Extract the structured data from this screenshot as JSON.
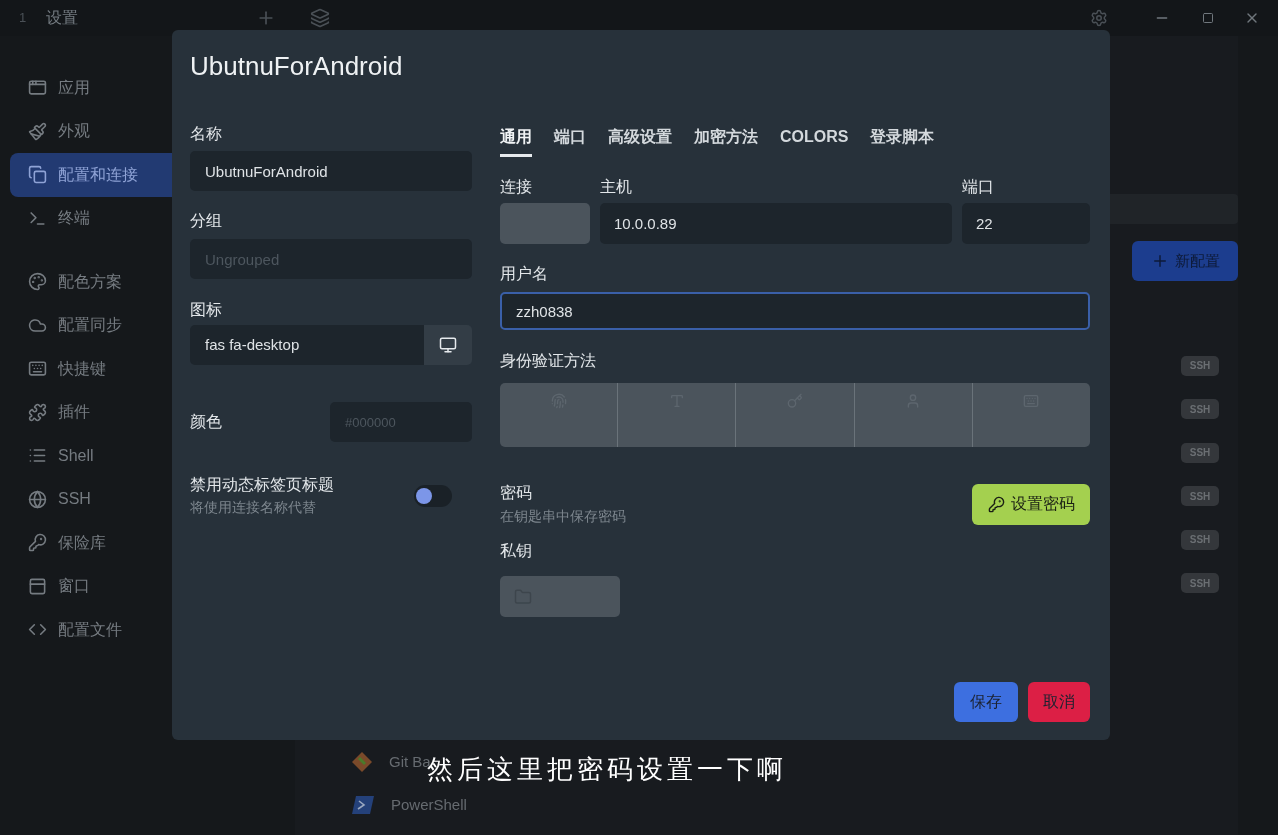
{
  "titlebar": {
    "tab_number": "1",
    "tab_title": "设置"
  },
  "sidebar": {
    "sections": [
      {
        "items": [
          {
            "label": "应用",
            "selected": false
          },
          {
            "label": "外观",
            "selected": false
          },
          {
            "label": "配置和连接",
            "selected": true
          },
          {
            "label": "终端",
            "selected": false
          }
        ]
      },
      {
        "items": [
          {
            "label": "配色方案",
            "selected": false
          },
          {
            "label": "配置同步",
            "selected": false
          },
          {
            "label": "快捷键",
            "selected": false
          },
          {
            "label": "插件",
            "selected": false
          },
          {
            "label": "Shell",
            "selected": false
          },
          {
            "label": "SSH",
            "selected": false
          },
          {
            "label": "保险库",
            "selected": false
          },
          {
            "label": "窗口",
            "selected": false
          },
          {
            "label": "配置文件",
            "selected": false
          }
        ]
      }
    ]
  },
  "profiles_page": {
    "new_button": "新配置",
    "ssh_rows": [
      {
        "badge": "SSH"
      },
      {
        "badge": "SSH"
      },
      {
        "badge": "SSH"
      },
      {
        "badge": "SSH"
      },
      {
        "badge": "SSH"
      },
      {
        "badge": "SSH"
      }
    ],
    "local_rows": [
      {
        "name": "Git Ba"
      },
      {
        "name": "PowerShell"
      }
    ]
  },
  "dialog": {
    "title": "UbutnuForAndroid",
    "name": {
      "label": "名称",
      "value": "UbutnuForAndroid"
    },
    "group": {
      "label": "分组",
      "placeholder": "Ungrouped"
    },
    "icon": {
      "label": "图标",
      "value": "fas fa-desktop"
    },
    "color": {
      "label": "颜色",
      "placeholder": "#000000"
    },
    "dynamic_title": {
      "label": "禁用动态标签页标题",
      "description": "将使用连接名称代替",
      "on": false
    },
    "tabs": [
      {
        "label": "通用",
        "selected": true
      },
      {
        "label": "端口",
        "selected": false
      },
      {
        "label": "高级设置",
        "selected": false
      },
      {
        "label": "加密方法",
        "selected": false
      },
      {
        "label": "COLORS",
        "selected": false
      },
      {
        "label": "登录脚本",
        "selected": false
      }
    ],
    "connection": {
      "label": "连接",
      "disabled": true
    },
    "host": {
      "label": "主机",
      "value": "10.0.0.89"
    },
    "port": {
      "label": "端口",
      "value": "22"
    },
    "username": {
      "label": "用户名",
      "value": "zzh0838",
      "focused": true
    },
    "auth_method": {
      "label": "身份验证方法",
      "disabled": true
    },
    "password": {
      "label": "密码",
      "description": "在钥匙串中保存密码",
      "button": "设置密码"
    },
    "private_key": {
      "label": "私钥",
      "disabled": true
    },
    "buttons": [
      {
        "kind": "primary",
        "label": "保存"
      },
      {
        "kind": "danger",
        "label": "取消"
      }
    ]
  },
  "subtitle": "然后这里把密码设置一下啊"
}
